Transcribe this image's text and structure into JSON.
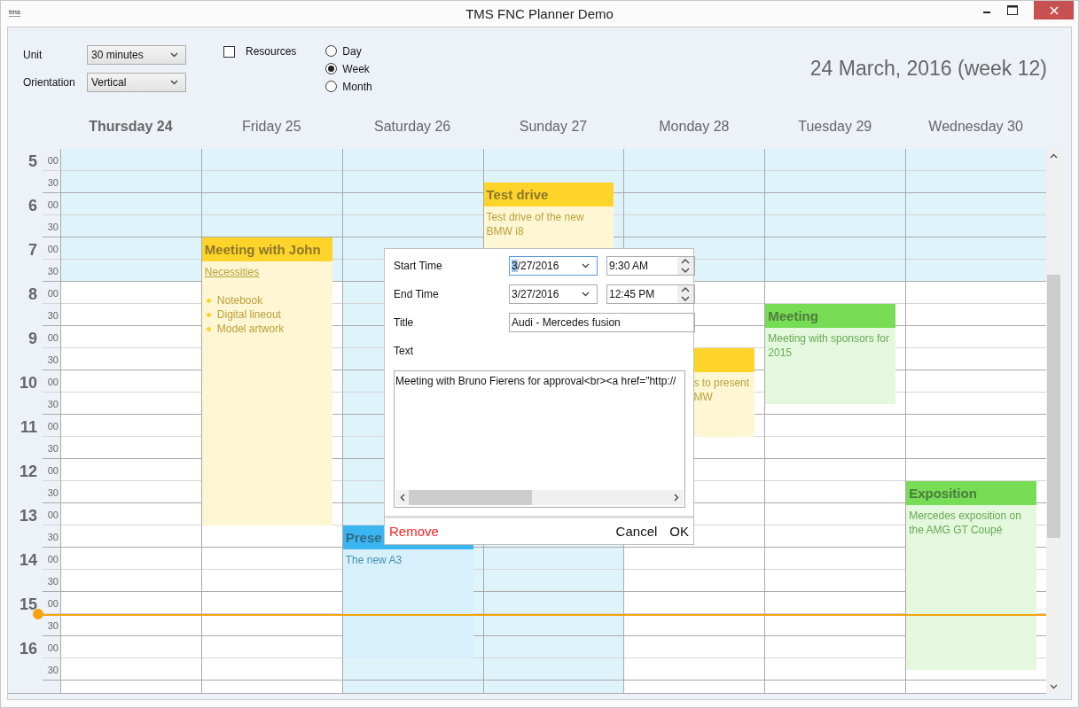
{
  "window": {
    "logo": "tms",
    "title": "TMS FNC Planner Demo"
  },
  "toolbar": {
    "unit": {
      "label": "Unit",
      "value": "30 minutes"
    },
    "orientation": {
      "label": "Orientation",
      "value": "Vertical"
    },
    "resources": {
      "label": "Resources",
      "checked": false
    },
    "views": [
      {
        "label": "Day",
        "selected": false
      },
      {
        "label": "Week",
        "selected": true
      },
      {
        "label": "Month",
        "selected": false
      }
    ],
    "date_title": "24 March, 2016 (week 12)"
  },
  "days": [
    {
      "label": "Thursday 24",
      "selected": true,
      "weekend": false
    },
    {
      "label": "Friday 25",
      "selected": false,
      "weekend": false
    },
    {
      "label": "Saturday 26",
      "selected": false,
      "weekend": true
    },
    {
      "label": "Sunday 27",
      "selected": false,
      "weekend": true
    },
    {
      "label": "Monday 28",
      "selected": false,
      "weekend": false
    },
    {
      "label": "Tuesday 29",
      "selected": false,
      "weekend": false
    },
    {
      "label": "Wednesday 30",
      "selected": false,
      "weekend": false
    }
  ],
  "time_slots": [
    {
      "hour": "5",
      "minute": "00"
    },
    {
      "minute": "30"
    },
    {
      "hour": "6",
      "minute": "00"
    },
    {
      "minute": "30"
    },
    {
      "hour": "7",
      "minute": "00"
    },
    {
      "minute": "30"
    },
    {
      "hour": "8",
      "minute": "00"
    },
    {
      "minute": "30"
    },
    {
      "hour": "9",
      "minute": "00"
    },
    {
      "minute": "30"
    },
    {
      "hour": "10",
      "minute": "00"
    },
    {
      "minute": "30"
    },
    {
      "hour": "11",
      "minute": "00"
    },
    {
      "minute": "30"
    },
    {
      "hour": "12",
      "minute": "00"
    },
    {
      "minute": "30"
    },
    {
      "hour": "13",
      "minute": "00"
    },
    {
      "minute": "30"
    },
    {
      "hour": "14",
      "minute": "00"
    },
    {
      "minute": "30"
    },
    {
      "hour": "15",
      "minute": "00"
    },
    {
      "minute": "30"
    },
    {
      "hour": "16",
      "minute": "00"
    },
    {
      "minute": "30"
    }
  ],
  "events": [
    {
      "color": "#ffd42a",
      "title": "Meeting with John",
      "body": [
        {
          "kind": "link",
          "text": "Necessities"
        },
        {
          "kind": "bullets",
          "items": [
            "Notebook",
            "Digital lineout",
            "Model artwork"
          ]
        }
      ]
    },
    {
      "color": "#ffd42a",
      "title": "Test drive",
      "body": [
        {
          "kind": "text",
          "text": "Test drive of the new BMW i8"
        }
      ]
    },
    {
      "color": "#ffd42a",
      "covered": true,
      "body": [
        {
          "kind": "text",
          "text": "s to present"
        },
        {
          "kind": "text",
          "text": "MW"
        }
      ]
    },
    {
      "color": "#77dd55",
      "title": "Meeting",
      "body": [
        {
          "kind": "text",
          "text": "Meeting with sponsors for 2015"
        }
      ]
    },
    {
      "color": "#77dd55",
      "title": "Exposition",
      "body": [
        {
          "kind": "text",
          "text": "Mercedes exposition on the AMG GT Coupé"
        }
      ]
    },
    {
      "color": "#3bb5f0",
      "title": "Prese",
      "body": [
        {
          "kind": "text",
          "text": "The new A3"
        }
      ]
    }
  ],
  "dialog": {
    "start_time": {
      "label": "Start Time",
      "date": "3/27/2016",
      "time": "9:30 AM",
      "focused": true
    },
    "end_time": {
      "label": "End Time",
      "date": "3/27/2016",
      "time": "12:45 PM",
      "focused": false
    },
    "title": {
      "label": "Title",
      "value": "Audi - Mercedes fusion"
    },
    "text": {
      "label": "Text",
      "value": "Meeting with Bruno Fierens for approval<br><a href=\"http://"
    },
    "remove": "Remove",
    "cancel": "Cancel",
    "ok": "OK"
  }
}
